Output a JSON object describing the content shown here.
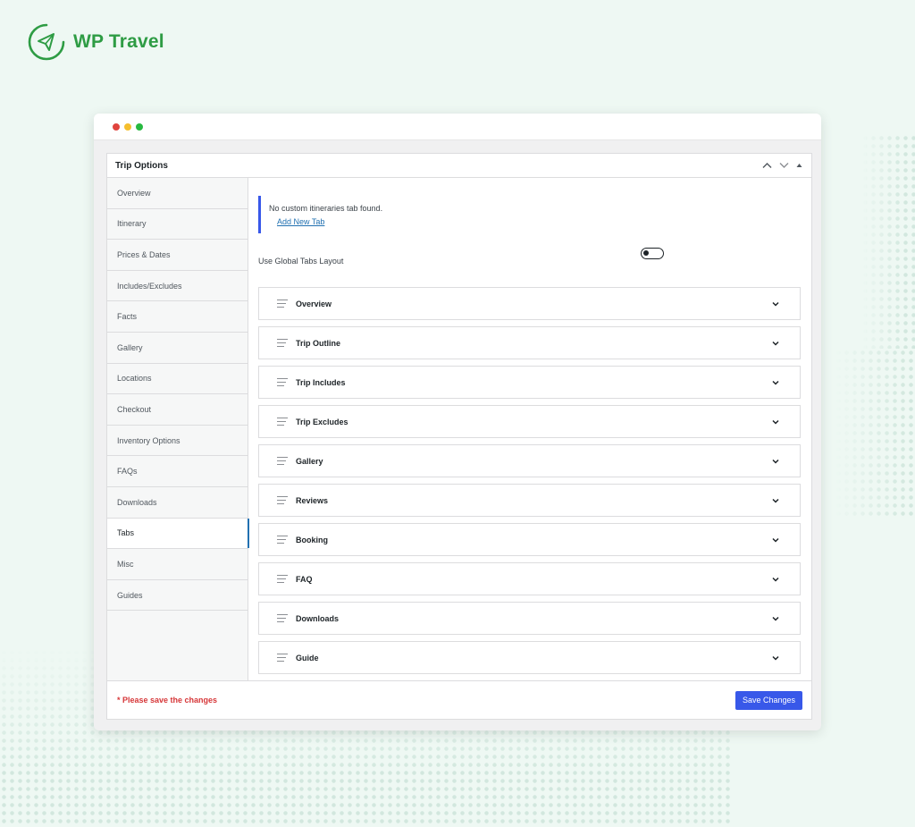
{
  "brand": {
    "name": "WP Travel",
    "color": "#2e9c44",
    "icon": "paper-plane-icon"
  },
  "window_dots": [
    "#e0443e",
    "#f5bf2e",
    "#27b940"
  ],
  "metabox": {
    "title": "Trip Options",
    "controls": [
      "chevron-up-icon",
      "chevron-down-icon",
      "triangle-up-icon"
    ]
  },
  "sidebar": {
    "active": "Tabs",
    "items": [
      {
        "label": "Overview"
      },
      {
        "label": "Itinerary"
      },
      {
        "label": "Prices & Dates"
      },
      {
        "label": "Includes/Excludes"
      },
      {
        "label": "Facts"
      },
      {
        "label": "Gallery"
      },
      {
        "label": "Locations"
      },
      {
        "label": "Checkout"
      },
      {
        "label": "Inventory Options"
      },
      {
        "label": "FAQs"
      },
      {
        "label": "Downloads"
      },
      {
        "label": "Tabs"
      },
      {
        "label": "Misc"
      },
      {
        "label": "Guides"
      }
    ]
  },
  "notice": {
    "text": "No custom itineraries tab found.",
    "link": "Add New Tab",
    "accent": "#3858e9"
  },
  "global_tabs": {
    "label": "Use Global Tabs Layout",
    "enabled": false
  },
  "tabs": [
    {
      "label": "Overview"
    },
    {
      "label": "Trip Outline"
    },
    {
      "label": "Trip Includes"
    },
    {
      "label": "Trip Excludes"
    },
    {
      "label": "Gallery"
    },
    {
      "label": "Reviews"
    },
    {
      "label": "Booking"
    },
    {
      "label": "FAQ"
    },
    {
      "label": "Downloads"
    },
    {
      "label": "Guide"
    }
  ],
  "footer": {
    "warning": "* Please save the changes",
    "warning_color": "#d63638",
    "save_label": "Save Changes",
    "save_color": "#3858e9"
  }
}
